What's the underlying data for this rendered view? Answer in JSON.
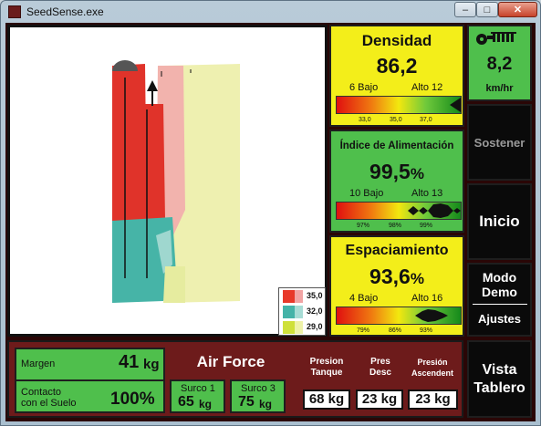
{
  "window": {
    "title": "SeedSense.exe",
    "minimize_glyph": "–",
    "maximize_glyph": "□",
    "close_glyph": "✕"
  },
  "map": {
    "legend": [
      {
        "value": "35,0",
        "colors": [
          "#e8392a",
          "#f1a4a4"
        ]
      },
      {
        "value": "32,0",
        "colors": [
          "#45b3a8",
          "#a7dcd5"
        ]
      },
      {
        "value": "29,0",
        "colors": [
          "#cfe03a",
          "#eef2a8"
        ]
      }
    ]
  },
  "densidad": {
    "title": "Densidad",
    "value": "86,2",
    "low": "6 Bajo",
    "high": "Alto 12",
    "ticks": [
      "33,0",
      "35,0",
      "37,0"
    ],
    "level": 0.97
  },
  "alimentacion": {
    "title": "Índice de Alimentación",
    "value": "99,5",
    "unit": "%",
    "low": "10 Bajo",
    "high": "Alto 13",
    "ticks": [
      "97%",
      "98%",
      "99%"
    ]
  },
  "espaciamiento": {
    "title": "Espaciamiento",
    "value": "93,6",
    "unit": "%",
    "low": "4 Bajo",
    "high": "Alto 16",
    "ticks": [
      "79%",
      "86%",
      "93%"
    ]
  },
  "speed": {
    "value": "8,2",
    "unit": "km/hr",
    "icon": "tractor-icon"
  },
  "buttons": {
    "sostener": "Sostener",
    "inicio": "Inicio",
    "modo_demo_1": "Modo",
    "modo_demo_2": "Demo",
    "ajustes": "Ajustes",
    "vista_1": "Vista",
    "vista_2": "Tablero"
  },
  "bottom": {
    "margen_label": "Margen",
    "margen_value": "41",
    "margen_unit": "kg",
    "contacto_label_1": "Contacto",
    "contacto_label_2": "con el Suelo",
    "contacto_value": "100%",
    "air_force": "Air Force",
    "surco1_label": "Surco 1",
    "surco1_value": "65",
    "surco1_unit": "kg",
    "surco3_label": "Surco 3",
    "surco3_value": "75",
    "surco3_unit": "kg",
    "presion_tanque_1": "Presion",
    "presion_tanque_2": "Tanque",
    "presion_tanque_value": "68 kg",
    "pres_desc_1": "Pres",
    "pres_desc_2": "Desc",
    "pres_desc_value": "23 kg",
    "presion_asc_1": "Presión",
    "presion_asc_2": "Ascendent",
    "presion_asc_value": "23 kg"
  },
  "colors": {
    "yellow_panel": "#f3ee1a",
    "green_panel": "#4fbf4c",
    "bottom_bar": "#6d1b1b",
    "button_black": "#0a0a0a"
  }
}
